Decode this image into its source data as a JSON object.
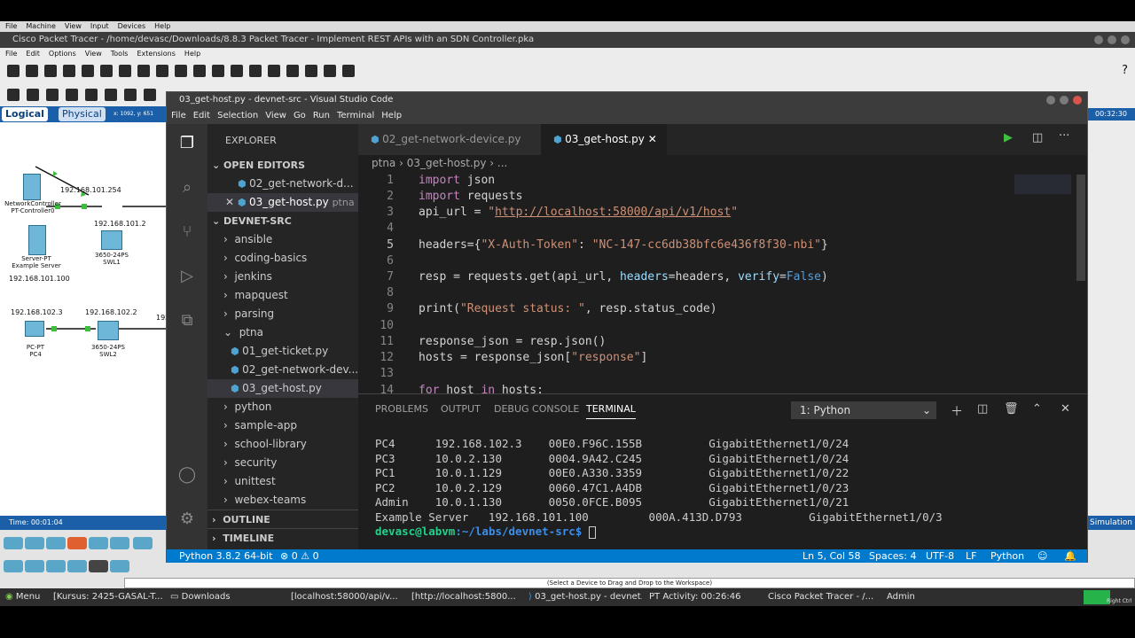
{
  "vm_menu": [
    "File",
    "Machine",
    "View",
    "Input",
    "Devices",
    "Help"
  ],
  "pt": {
    "title": "Cisco Packet Tracer - /home/devasc/Downloads/8.8.3 Packet Tracer - Implement REST APIs with an SDN Controller.pka",
    "menu": [
      "File",
      "Edit",
      "Options",
      "View",
      "Tools",
      "Extensions",
      "Help"
    ],
    "help_label": "?",
    "tab_logical": "Logical",
    "tab_physical": "Physical",
    "coords": "x: 1092, y: 651",
    "time_right": "00:32:30",
    "time_left": "Time: 00:01:04",
    "simulation": "Simulation",
    "drag_hint": "(Select a Device to Drag and Drop to the Workspace)",
    "devices": {
      "controller": "NetworkController\nPT-Controller0",
      "server": "Server-PT\nExample Server",
      "sw1": "3650-24PS\nSWL1",
      "pc4": "PC-PT\nPC4",
      "sw2": "3650-24PS\nSWL2"
    },
    "ips": {
      "ctrl_ip": "192.168.101.254",
      "sw1_ip": "192.168.101.2",
      "server_ip": "192.168.101.100",
      "pc4_ip": "192.168.102.3",
      "sw2_ip": "192.168.102.2",
      "cut_ip": "192"
    }
  },
  "vsc": {
    "title": "03_get-host.py - devnet-src - Visual Studio Code",
    "menu": [
      "File",
      "Edit",
      "Selection",
      "View",
      "Go",
      "Run",
      "Terminal",
      "Help"
    ],
    "explorer_label": "EXPLORER",
    "open_editors": "OPEN EDITORS",
    "open_files": [
      {
        "name": "02_get-network-d...",
        "dir": ""
      },
      {
        "name": "03_get-host.py",
        "dir": "ptna"
      }
    ],
    "root": "DEVNET-SRC",
    "folders_a": [
      "ansible",
      "coding-basics",
      "jenkins",
      "mapquest",
      "parsing"
    ],
    "ptna": "ptna",
    "ptna_files": [
      "01_get-ticket.py",
      "02_get-network-dev...",
      "03_get-host.py"
    ],
    "folders_b": [
      "python",
      "sample-app",
      "school-library",
      "security",
      "unittest",
      "webex-teams"
    ],
    "outline": "OUTLINE",
    "timeline": "TIMELINE",
    "tabs": [
      "02_get-network-device.py",
      "03_get-host.py"
    ],
    "breadcrumb": "ptna  ›  03_get-host.py  ›  ...",
    "code": {
      "l1a": "import",
      "l1b": " json",
      "l2a": "import",
      "l2b": " requests",
      "l3a": "api_url = ",
      "l3b": "\"",
      "l3c": "http://localhost:58000/api/v1/host",
      "l3d": "\"",
      "l5a": "headers",
      "l5b": "={",
      "l5c": "\"X-Auth-Token\"",
      "l5d": ": ",
      "l5e": "\"NC-147-cc6db38bfc6e436f8f30-nbi\"",
      "l5f": "}",
      "l7a": "resp = requests.get(api_url, ",
      "l7b": "headers",
      "l7c": "=headers, ",
      "l7d": "verify",
      "l7e": "=",
      "l7f": "False",
      "l7g": ")",
      "l9a": "print(",
      "l9b": "\"Request status: \"",
      "l9c": ", resp.status_code)",
      "l11": "response_json = resp.json()",
      "l12a": "hosts = response_json[",
      "l12b": "\"response\"",
      "l12c": "]",
      "l14a": "for",
      "l14b": " host ",
      "l14c": "in",
      "l14d": " hosts:"
    },
    "panel_tabs": [
      "PROBLEMS",
      "OUTPUT",
      "DEBUG CONSOLE",
      "TERMINAL"
    ],
    "terminal_select": "1: Python",
    "terminal_lines": [
      "PC4      192.168.102.3    00E0.F96C.155B          GigabitEthernet1/0/24",
      "PC3      10.0.2.130       0004.9A42.C245          GigabitEthernet1/0/24",
      "PC1      10.0.1.129       00E0.A330.3359          GigabitEthernet1/0/22",
      "PC2      10.0.2.129       0060.47C1.A4DB          GigabitEthernet1/0/23",
      "Admin    10.0.1.130       0050.0FCE.B095          GigabitEthernet1/0/21",
      "Example Server   192.168.101.100         000A.413D.D793          GigabitEthernet1/0/3"
    ],
    "prompt_user": "devasc@labvm",
    "prompt_path": ":~/labs/devnet-src$",
    "status": {
      "python": "Python 3.8.2 64-bit",
      "problems": "⊗ 0 ⚠ 0",
      "position": "Ln 5, Col 58",
      "spaces": "Spaces: 4",
      "encoding": "UTF-8",
      "eol": "LF",
      "lang": "Python"
    }
  },
  "taskbar": {
    "menu": "Menu",
    "items": [
      "[Kursus: 2425-GASAL-T...",
      "Downloads",
      "[localhost:58000/api/v...",
      "[http://localhost:5800...",
      "03_get-host.py - devnet...",
      "PT Activity: 00:26:46",
      "Cisco Packet Tracer - /...",
      "Admin"
    ],
    "right_ctrl": "Right Ctrl"
  }
}
